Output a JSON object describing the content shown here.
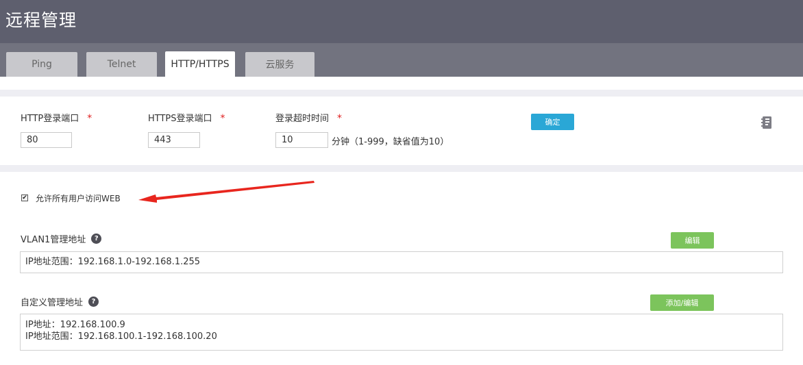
{
  "header": {
    "title": "远程管理"
  },
  "tabs": [
    {
      "label": "Ping",
      "active": false
    },
    {
      "label": "Telnet",
      "active": false
    },
    {
      "label": "HTTP/HTTPS",
      "active": true
    },
    {
      "label": "云服务",
      "active": false
    }
  ],
  "settings": {
    "http_port_label": "HTTP登录端口",
    "http_port_value": "80",
    "https_port_label": "HTTPS登录端口",
    "https_port_value": "443",
    "timeout_label": "登录超时时间",
    "timeout_value": "10",
    "timeout_hint": "分钟（1-999，缺省值为10）",
    "required_mark": "*",
    "confirm_label": "确定"
  },
  "allow_all": {
    "label": "允许所有用户访问WEB",
    "checked": true
  },
  "vlan1": {
    "label": "VLAN1管理地址",
    "edit_label": "编辑",
    "lines": [
      "IP地址范围：192.168.1.0-192.168.1.255"
    ]
  },
  "custom": {
    "label": "自定义管理地址",
    "edit_label": "添加/编辑",
    "lines": [
      "IP地址：192.168.100.9",
      "IP地址范围：192.168.100.1-192.168.100.20"
    ]
  },
  "help_glyph": "?",
  "colors": {
    "header_bg": "#5e5f6e",
    "tabbar_bg": "#72737f",
    "confirm_button": "#2aa7d6",
    "edit_button": "#7cc45c",
    "required": "#e02020",
    "annotation_arrow": "#e8261e"
  },
  "icons": {
    "side_icon": "notebook-icon",
    "help": "help-icon",
    "annotation": "red-arrow-icon"
  }
}
